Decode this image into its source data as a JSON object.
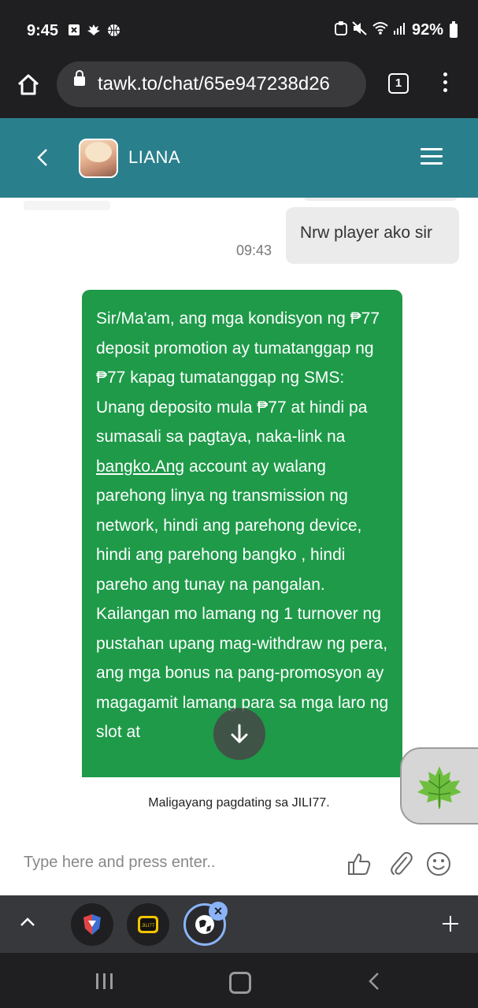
{
  "status_bar": {
    "time": "9:45",
    "left_icons": [
      "close-notification-icon",
      "leaf-notification-icon",
      "basketball-icon"
    ],
    "battery": "92%",
    "right_icons": [
      "nfc-icon",
      "mute-icon",
      "wifi-icon",
      "signal-icon",
      "battery-icon"
    ]
  },
  "browser": {
    "url": "tawk.to/chat/65e947238d26",
    "tab_count": "1"
  },
  "chat_header": {
    "agent_name": "LIANA"
  },
  "messages": {
    "user_message": "Nrw player ako sir",
    "user_time": "09:43",
    "agent_message_part1": "Sir/Ma'am, ang mga kondisyon ng ₱77 deposit promotion ay tumatanggap ng ₱77 kapag tumatanggap ng SMS: Unang deposito mula ₱77 at hindi pa sumasali sa pagtaya, naka-link na ",
    "agent_message_link": "bangko.Ang",
    "agent_message_part2": " account ay walang parehong linya ng transmission ng network, hindi ang parehong device, hindi ang parehong bangko , hindi pareho ang tunay na pangalan. Kailangan mo lamang ng 1 turnover ng pustahan upang mag-withdraw ng pera, ang mga bonus na pang-promosyon ay magagamit lamang para sa mga laro ng slot at"
  },
  "welcome": {
    "text": "Maligayang pagdating sa JILI77."
  },
  "input": {
    "placeholder": "Type here and press enter.."
  },
  "colors": {
    "header": "#2a7f8c",
    "agent_bubble": "#1e9a49",
    "user_bubble": "#ebebeb"
  }
}
